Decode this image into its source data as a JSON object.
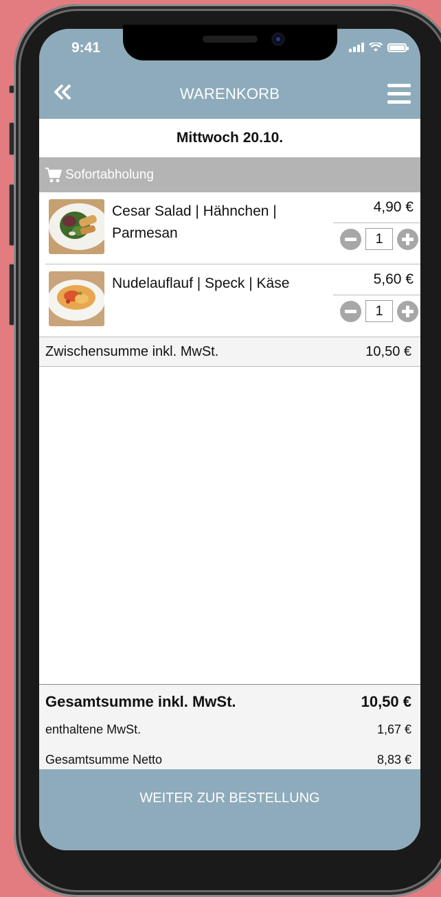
{
  "status": {
    "time": "9:41"
  },
  "header": {
    "title": "WARENKORB"
  },
  "date": "Mittwoch 20.10.",
  "section": {
    "label": "Sofortabholung",
    "icon": "cart-icon"
  },
  "items": [
    {
      "name": "Cesar Salad | Hähnchen | Parmesan",
      "price": "4,90 €",
      "quantity": "1"
    },
    {
      "name": "Nudelauflauf | Speck | Käse",
      "price": "5,60 €",
      "quantity": "1"
    }
  ],
  "subtotal": {
    "label": "Zwischensumme inkl. MwSt.",
    "value": "10,50 €"
  },
  "totals": {
    "gross_label": "Gesamtsumme inkl. MwSt.",
    "gross_value": "10,50 €",
    "vat_label": "enthaltene MwSt.",
    "vat_value": "1,67 €",
    "net_label": "Gesamtsumme Netto",
    "net_value": "8,83 €"
  },
  "order_button": "WEITER ZUR BESTELLUNG",
  "colors": {
    "accent": "#8eabbb",
    "section": "#b4b4b4",
    "background": "#e37c80"
  }
}
